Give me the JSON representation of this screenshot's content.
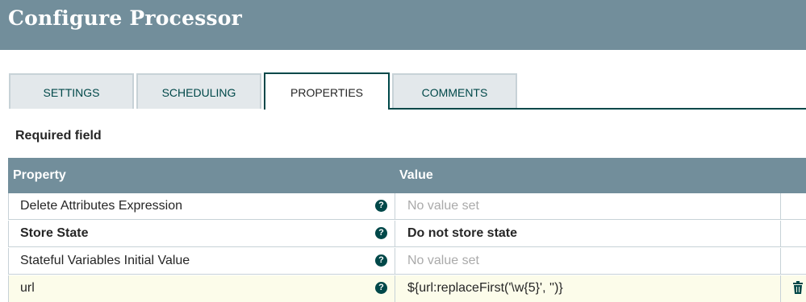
{
  "header": {
    "title": "Configure Processor"
  },
  "tabs": [
    {
      "label": "SETTINGS"
    },
    {
      "label": "SCHEDULING"
    },
    {
      "label": "PROPERTIES"
    },
    {
      "label": "COMMENTS"
    }
  ],
  "required_label": "Required field",
  "table": {
    "headers": {
      "property": "Property",
      "value": "Value"
    },
    "rows": [
      {
        "property": "Delete Attributes Expression",
        "value": "No value set",
        "help": "?"
      },
      {
        "property": "Store State",
        "value": "Do not store state",
        "help": "?"
      },
      {
        "property": "Stateful Variables Initial Value",
        "value": "No value set",
        "help": "?"
      },
      {
        "property": "url",
        "value": "${url:replaceFirst('\\w{5}', '')}",
        "help": "?"
      }
    ]
  },
  "colors": {
    "header_bg": "#728e9b",
    "accent": "#004849",
    "row_highlight": "#fcfcea"
  },
  "icons": {
    "help": "help-circle-icon",
    "delete": "trash-icon"
  }
}
